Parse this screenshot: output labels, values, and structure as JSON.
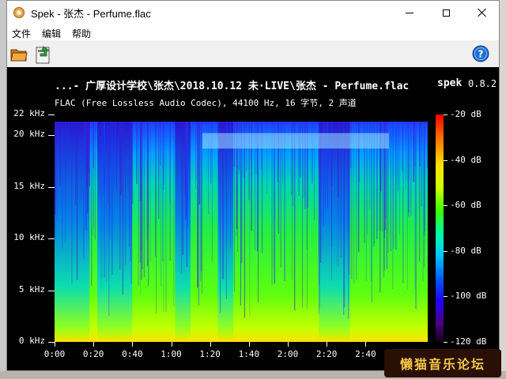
{
  "window": {
    "title": "Spek - 张杰 - Perfume.flac"
  },
  "menu": [
    "文件",
    "编辑",
    "帮助"
  ],
  "toolbar": {
    "open_icon": "folder-open-icon",
    "save_icon": "save-icon",
    "help_icon": "help-icon"
  },
  "spectrogram": {
    "title": "...- 广厚设计学校\\张杰\\2018.10.12 未·LIVE\\张杰 - Perfume.flac",
    "app_name": "spek",
    "version": "0.8.2",
    "subtitle": "FLAC (Free Lossless Audio Codec), 44100 Hz, 16 字节, 2 声道"
  },
  "chart_data": {
    "type": "heatmap",
    "y_unit_labels": [
      "22 kHz",
      "20 kHz",
      "15 kHz",
      "10 kHz",
      "5 kHz",
      "0 kHz"
    ],
    "y_values_khz": [
      22,
      20,
      15,
      10,
      5,
      0
    ],
    "ylim_khz": [
      0,
      22
    ],
    "x_tick_labels": [
      "0:00",
      "0:20",
      "0:40",
      "1:00",
      "1:20",
      "1:40",
      "2:00",
      "2:20",
      "2:40"
    ],
    "x_values_s": [
      0,
      20,
      40,
      60,
      80,
      100,
      120,
      140,
      160
    ],
    "xlim_s": [
      0,
      192
    ],
    "colorbar_labels": [
      "-20 dB",
      "-40 dB",
      "-60 dB",
      "-80 dB",
      "-100 dB",
      "-120 dB"
    ],
    "colorbar_values_db": [
      -20,
      -40,
      -60,
      -80,
      -100,
      -120
    ],
    "colorbar_range_db": [
      -120,
      -20
    ],
    "colors": {
      "high": "#ffe000",
      "mid": "#3cff00",
      "low": "#005cff",
      "floor": "#2200ff"
    }
  },
  "watermark": {
    "text": "懒猫音乐论坛"
  }
}
